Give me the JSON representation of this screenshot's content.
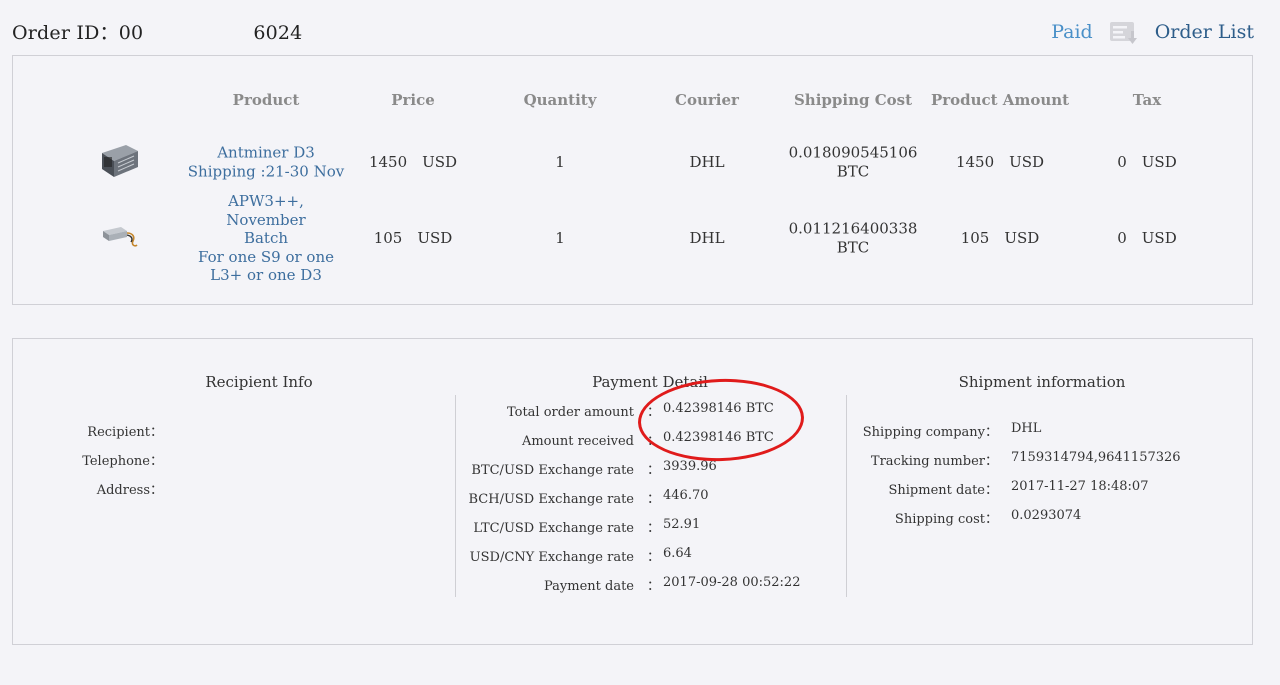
{
  "header": {
    "order_id_label": "Order ID：00",
    "order_id_value": "6024",
    "status_link": "Paid",
    "order_list_link": "Order List"
  },
  "products_table": {
    "columns": [
      "Product",
      "Price",
      "Quantity",
      "Courier",
      "Shipping Cost",
      "Product Amount",
      "Tax"
    ],
    "rows": [
      {
        "image_icon": "antminer-image",
        "product_line1": "Antminer D3",
        "product_line2": "Shipping :21-30 Nov",
        "price": "1450　USD",
        "quantity": "1",
        "courier": "DHL",
        "shipping_cost_line1": "0.018090545106",
        "shipping_cost_line2": "BTC",
        "product_amount": "1450　USD",
        "tax": "0　USD"
      },
      {
        "image_icon": "power-supply-image",
        "product_line1": "APW3++, November",
        "product_line2": "Batch",
        "product_line3": "For one S9 or one",
        "product_line4": "L3+ or one D3",
        "price": "105　USD",
        "quantity": "1",
        "courier": "DHL",
        "shipping_cost_line1": "0.011216400338",
        "shipping_cost_line2": "BTC",
        "product_amount": "105　USD",
        "tax": "0　USD"
      }
    ]
  },
  "recipient": {
    "title": "Recipient Info",
    "fields": [
      {
        "label": "Recipient：",
        "value": ""
      },
      {
        "label": "Telephone：",
        "value": ""
      },
      {
        "label": "Address：",
        "value": ""
      }
    ]
  },
  "payment": {
    "title": "Payment Detail",
    "fields": [
      {
        "label": "Total order amount　：",
        "value": "0.42398146 BTC"
      },
      {
        "label": "Amount received　：",
        "value": "0.42398146 BTC"
      },
      {
        "label": "BTC/USD Exchange rate　：",
        "value": "3939.96"
      },
      {
        "label": "BCH/USD Exchange rate　：",
        "value": "446.70"
      },
      {
        "label": "LTC/USD Exchange rate　：",
        "value": "52.91"
      },
      {
        "label": "USD/CNY Exchange rate　：",
        "value": "6.64"
      },
      {
        "label": "Payment date　：",
        "value": "2017-09-28 00:52:22"
      }
    ]
  },
  "shipment": {
    "title": "Shipment information",
    "fields": [
      {
        "label": "Shipping company：",
        "value": "DHL"
      },
      {
        "label": "Tracking number：",
        "value": "7159314794,9641157326"
      },
      {
        "label": "Shipment date：",
        "value": "2017-11-27 18:48:07"
      },
      {
        "label": "Shipping cost：",
        "value": "0.0293074"
      }
    ]
  },
  "colors": {
    "link": "#4a90c8",
    "product_link": "#3d6e9e",
    "header_gray": "#8a8a8a",
    "annotation_red": "#e01b1b"
  }
}
